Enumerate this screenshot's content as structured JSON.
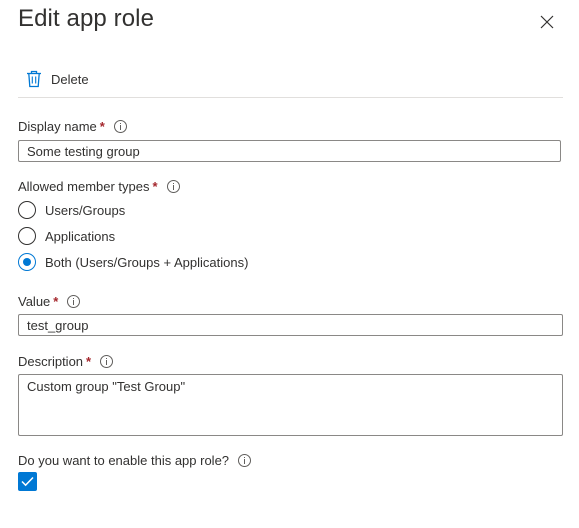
{
  "panel": {
    "title": "Edit app role"
  },
  "toolbar": {
    "delete_label": "Delete"
  },
  "display_name": {
    "label": "Display name",
    "required": "*",
    "value": "Some testing group"
  },
  "member_types": {
    "label": "Allowed member types",
    "required": "*",
    "options": [
      {
        "label": "Users/Groups",
        "checked": false
      },
      {
        "label": "Applications",
        "checked": false
      },
      {
        "label": "Both (Users/Groups + Applications)",
        "checked": true
      }
    ]
  },
  "value_field": {
    "label": "Value",
    "required": "*",
    "value": "test_group"
  },
  "description": {
    "label": "Description",
    "required": "*",
    "value": "Custom group \"Test Group\""
  },
  "enable": {
    "label": "Do you want to enable this app role?",
    "checked": true
  },
  "colors": {
    "accent": "#0078d4",
    "required": "#a4262c",
    "border": "#8a8886",
    "text": "#323130"
  },
  "icons": [
    "close-icon",
    "trash-icon",
    "info-icon",
    "checkmark-icon"
  ]
}
